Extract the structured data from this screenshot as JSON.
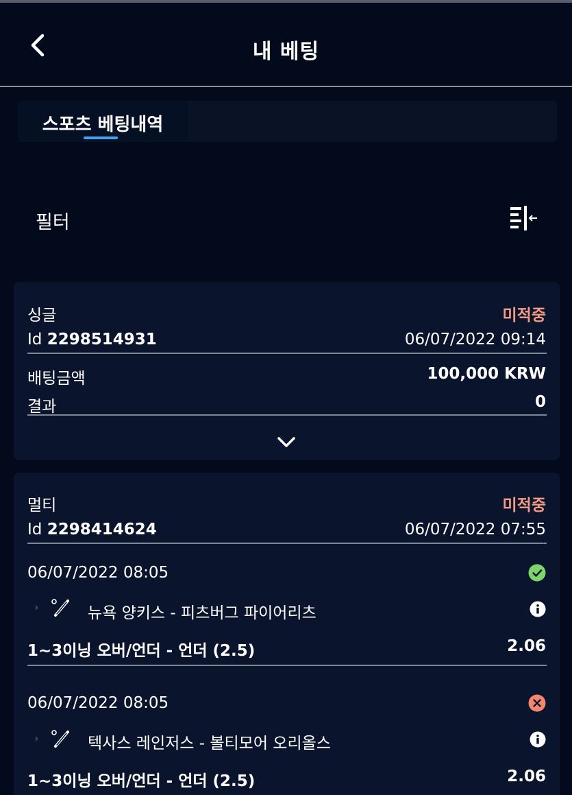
{
  "header": {
    "title": "내 베팅"
  },
  "tabs": [
    {
      "label": "스포츠 베팅내역",
      "active": true
    }
  ],
  "filter": {
    "label": "필터"
  },
  "bets": [
    {
      "type": "싱글",
      "status": "미적중",
      "id_label": "Id",
      "id": "2298514931",
      "datetime": "06/07/2022 09:14",
      "stake_label": "배팅금액",
      "stake": "100,000 KRW",
      "result_label": "결과",
      "result": "0"
    },
    {
      "type": "멀티",
      "status": "미적중",
      "id_label": "Id",
      "id": "2298414624",
      "datetime": "06/07/2022 07:55",
      "legs": [
        {
          "datetime": "06/07/2022 08:05",
          "outcome": "won",
          "event": "뉴욕 양키스 - 피츠버그 파이어리츠",
          "market": "1~3이닝 오버/언더 - 언더 (2.5)",
          "odds": "2.06"
        },
        {
          "datetime": "06/07/2022 08:05",
          "outcome": "lost",
          "event": "텍사스 레인저스 - 볼티모어 오리올스",
          "market": "1~3이닝 오버/언더 - 언더 (2.5)",
          "odds": "2.06"
        }
      ]
    }
  ],
  "colors": {
    "background": "#030a1c",
    "card": "#0a152d",
    "status_lost": "#f39b84",
    "won_icon": "#7ed36a",
    "lost_icon": "#f4856f",
    "tab_underline": "#3ea4f2"
  }
}
